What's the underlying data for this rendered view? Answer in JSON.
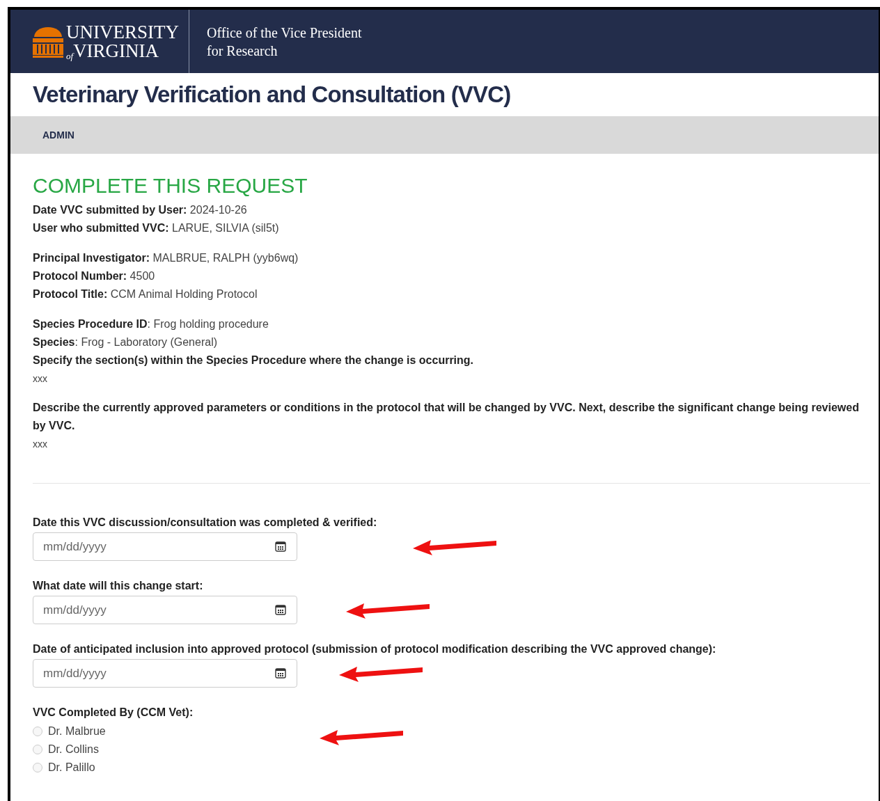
{
  "header": {
    "logo_lines": [
      "UNIVERSITY",
      "of",
      "VIRGINIA"
    ],
    "office_lines": [
      "Office of the Vice President",
      "for Research"
    ]
  },
  "page_title": "Veterinary Verification and Consultation (VVC)",
  "nav": {
    "items": [
      {
        "label": "ADMIN",
        "selected": false
      }
    ]
  },
  "section_title": "COMPLETE THIS REQUEST",
  "info_groups": [
    [
      {
        "label": "Date VVC submitted by User:",
        "value": "2024-10-26"
      },
      {
        "label": "User who submitted VVC:",
        "value": "LARUE, SILVIA (sil5t)"
      }
    ],
    [
      {
        "label": "Principal Investigator:",
        "value": "MALBRUE, RALPH (yyb6wq)"
      },
      {
        "label": "Protocol Number:",
        "value": "4500"
      },
      {
        "label": "Protocol Title:",
        "value": "CCM Animal Holding Protocol"
      }
    ],
    [
      {
        "label": "Species Procedure ID",
        "value": ": Frog holding procedure"
      },
      {
        "label": "Species",
        "value": ": Frog - Laboratory (General)"
      }
    ]
  ],
  "questions": [
    {
      "question": "Specify the section(s) within the Species Procedure where the change is occurring.",
      "answer": "xxx"
    },
    {
      "question": "Describe the currently approved parameters or conditions in the protocol that will be changed by VVC. Next, describe the significant change being reviewed by VVC.",
      "answer": "xxx"
    }
  ],
  "date_fields": [
    {
      "label": "Date this VVC discussion/consultation was completed & verified:",
      "placeholder": "mm/dd/yyyy",
      "arrow": true
    },
    {
      "label": "What date will this change start:",
      "placeholder": "mm/dd/yyyy",
      "arrow": true
    },
    {
      "label": "Date of anticipated inclusion into approved protocol (submission of protocol modification describing the VVC approved change):",
      "placeholder": "mm/dd/yyyy",
      "arrow": true
    }
  ],
  "completed_by": {
    "label": "VVC Completed By (CCM Vet):",
    "arrow": true,
    "options": [
      {
        "label": "Dr. Malbrue",
        "selected": false
      },
      {
        "label": "Dr. Collins",
        "selected": false
      },
      {
        "label": "Dr. Palillo",
        "selected": false
      }
    ]
  }
}
